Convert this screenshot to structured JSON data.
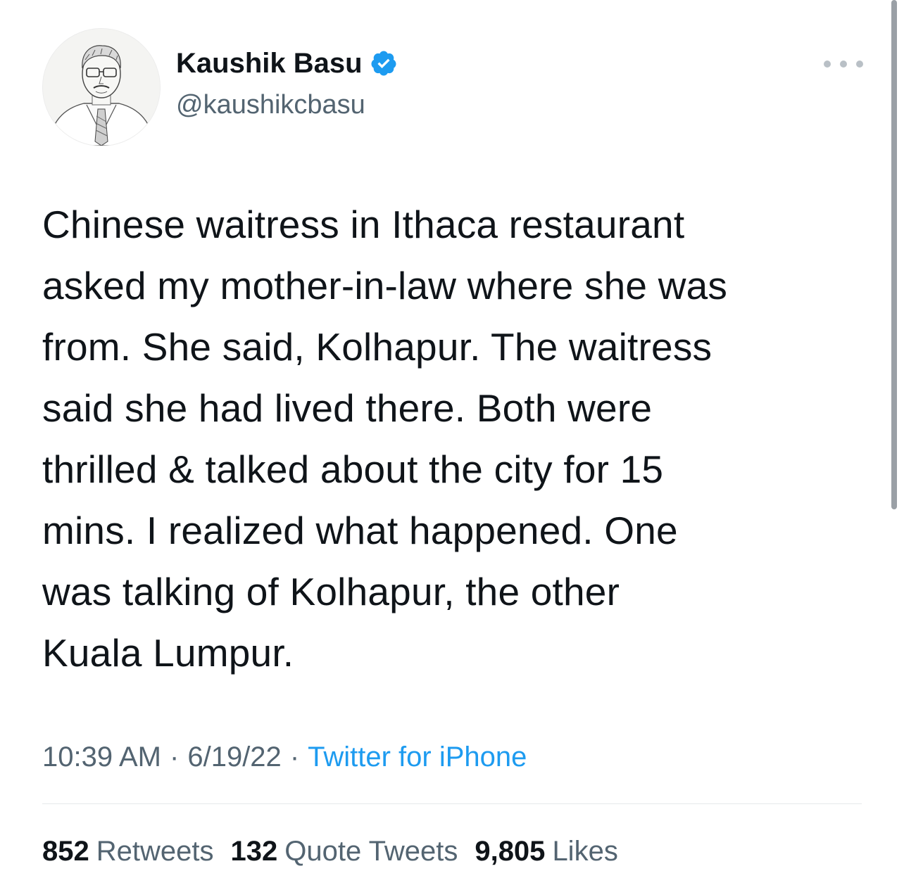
{
  "author": {
    "name": "Kaushik Basu",
    "handle": "@kaushikcbasu",
    "verified": true
  },
  "icons": {
    "verified": "verified-badge-icon",
    "more": "more-options-icon",
    "avatar": "sketch-portrait-avatar"
  },
  "tweet": {
    "text": "Chinese waitress in Ithaca restaurant\nasked my mother-in-law where she was\nfrom. She said, Kolhapur. The waitress\nsaid she had lived there. Both were\nthrilled & talked about the city for 15\nmins. I realized what happened. One\nwas talking of Kolhapur, the other\nKuala Lumpur.",
    "time": "10:39 AM",
    "date": "6/19/22",
    "source": "Twitter for iPhone",
    "separator": "·"
  },
  "stats": {
    "retweets_count": "852",
    "retweets_label": "Retweets",
    "quotes_count": "132",
    "quotes_label": "Quote Tweets",
    "likes_count": "9,805",
    "likes_label": "Likes"
  },
  "colors": {
    "text": "#0f1419",
    "secondary": "#536471",
    "accent": "#1d9bf0",
    "background": "#ffffff"
  }
}
